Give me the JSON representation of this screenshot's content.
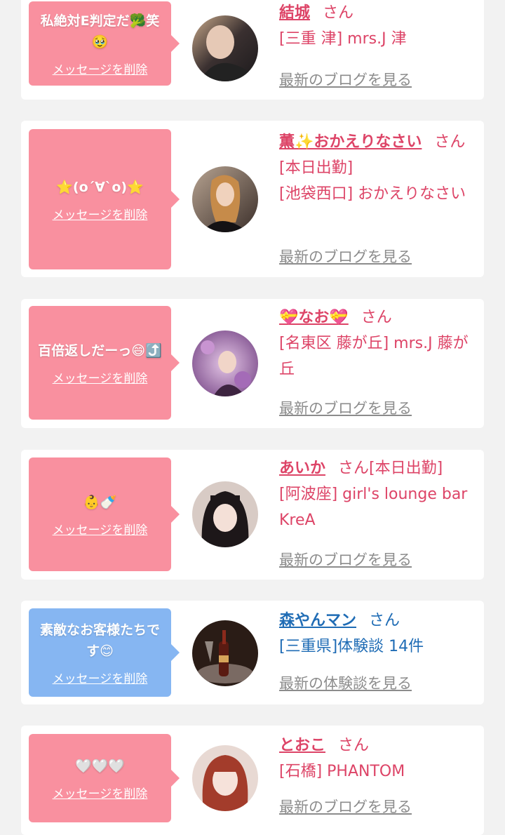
{
  "delete_label": "メッセージを削除",
  "cards": [
    {
      "message": "私絶対E判定だ🥦笑🥹",
      "name": "結城",
      "honorific": "さん",
      "location": "[三重 津] mrs.J 津",
      "blog_link": "最新のブログを見る"
    },
    {
      "message": "⭐(o´∀`o)⭐",
      "name": "薫✨おかえりなさい",
      "honorific": "さん[本日出勤]",
      "location": "[池袋西口] おかえりなさい",
      "blog_link": "最新のブログを見る"
    },
    {
      "message": "百倍返しだーっ😄⤴️",
      "name": "💝なお💝",
      "honorific": "さん",
      "location": "[名東区 藤が丘] mrs.J 藤が丘",
      "blog_link": "最新のブログを見る"
    },
    {
      "message": "👶🍼",
      "name": "あいか",
      "honorific": "さん[本日出勤]",
      "location": "[阿波座] girl's lounge bar KreA",
      "blog_link": "最新のブログを見る"
    },
    {
      "message": "素敵なお客様たちです😊",
      "name": "森やんマン",
      "honorific": "さん",
      "location": "[三重県]体験談 14件",
      "blog_link": "最新の体験談を見る"
    },
    {
      "message": "🤍🤍🤍",
      "name": "とおこ",
      "honorific": "さん",
      "location": "[石橋] PHANTOM",
      "blog_link": "最新のブログを見る"
    }
  ],
  "colors": {
    "accent_pink": "#dd4467",
    "accent_blue": "#1f6cb5",
    "bubble_pink": "#f9909f",
    "bubble_blue": "#86b6f2"
  }
}
